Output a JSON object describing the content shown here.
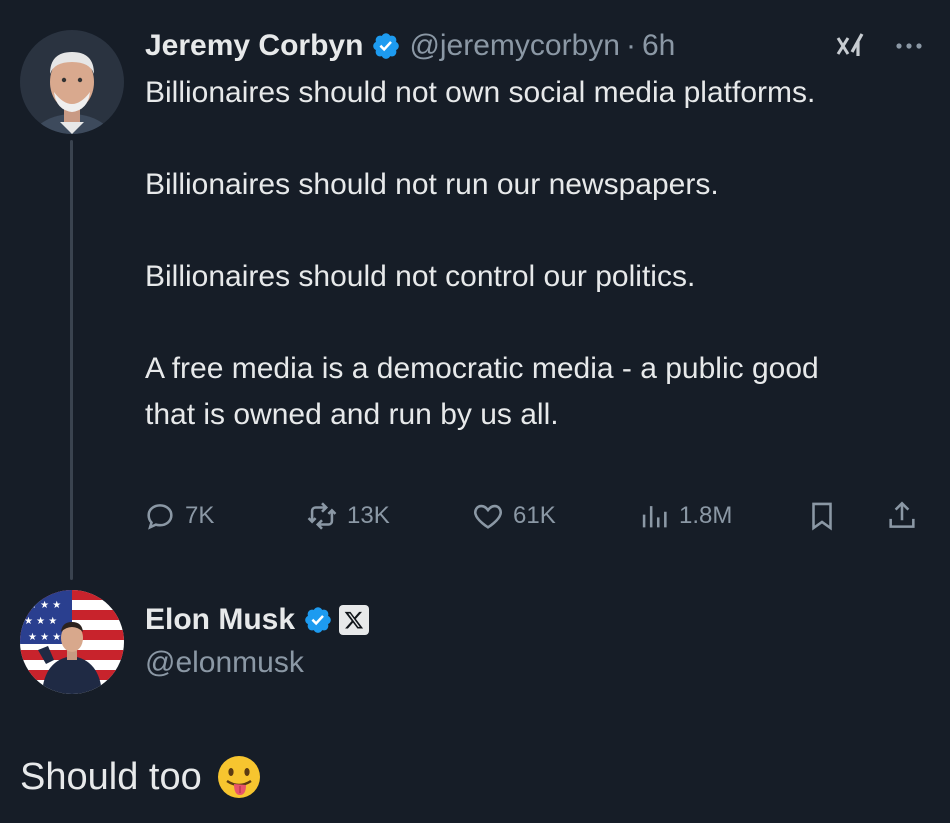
{
  "tweet": {
    "author_name": "Jeremy Corbyn",
    "author_handle": "@jeremycorbyn",
    "separator": "·",
    "time": "6h",
    "lines": [
      "Billionaires should not own social media platforms.",
      "Billionaires should not run our newspapers.",
      "Billionaires should not control our politics.",
      "A free media is a democratic media - a public good that is owned and run by us all."
    ],
    "stats": {
      "replies": "7K",
      "reposts": "13K",
      "likes": "61K",
      "views": "1.8M"
    }
  },
  "reply": {
    "author_name": "Elon Musk",
    "author_handle": "@elonmusk",
    "text": "Should too"
  },
  "colors": {
    "background": "#161d27",
    "text": "#e7e9ea",
    "muted": "#8b98a5",
    "verified": "#1d9bf0"
  }
}
